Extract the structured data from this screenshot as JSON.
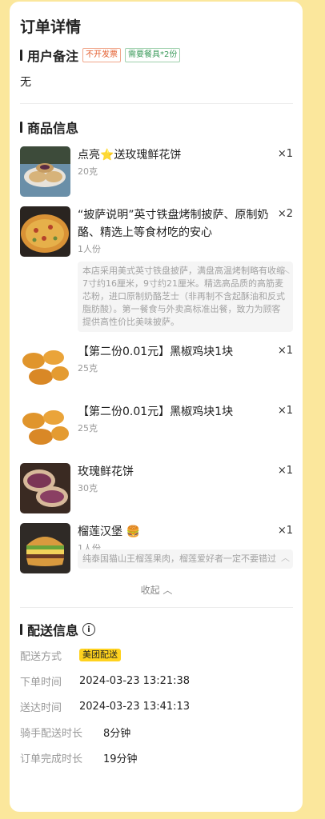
{
  "page_title": "订单详情",
  "remark_section": {
    "title": "用户备注",
    "tags": [
      "不开发票",
      "需要餐具*2份"
    ],
    "content": "无"
  },
  "products_section": {
    "title": "商品信息",
    "items": [
      {
        "name": "点亮",
        "star": "⭐",
        "name_suffix": "送玫瑰鲜花饼",
        "spec": "20克",
        "qty": "×1"
      },
      {
        "name": "“披萨说明”英寸铁盘烤制披萨、原制奶酪、精选上等食材吃的安心",
        "spec": "1人份",
        "qty": "×2",
        "desc": "本店采用美式英寸铁盘披萨，满盘高温烤制略有收缩7寸约16厘米，9寸约21厘米。精选高品质的高筋麦芯粉，进口原制奶酪芝士（非再制不含起酥油和反式脂肪酸）。第一餐食与外卖高标准出餐，致力为顾客提供高性价比美味披萨。",
        "desc_toggle": "︿"
      },
      {
        "name": "【第二份0.01元】黑椒鸡块1块",
        "spec": "25克",
        "qty": "×1"
      },
      {
        "name": "【第二份0.01元】黑椒鸡块1块",
        "spec": "25克",
        "qty": "×1"
      },
      {
        "name": "玫瑰鲜花饼",
        "spec": "30克",
        "qty": "×1"
      },
      {
        "name": "榴莲汉堡",
        "emoji": "🍔",
        "spec": "1人份",
        "qty": "×1",
        "desc": "纯泰国猫山王榴莲果肉，榴莲爱好者一定不要错过",
        "desc_toggle": "︿"
      }
    ],
    "collapse_label": "收起",
    "collapse_icon": "︿"
  },
  "delivery_section": {
    "title": "配送信息",
    "info_icon": "i",
    "rows": [
      {
        "label": "配送方式",
        "value": "美团配送"
      },
      {
        "label": "下单时间",
        "value": "2024-03-23 13:21:38"
      },
      {
        "label": "送达时间",
        "value": "2024-03-23 13:41:13"
      },
      {
        "label": "骑手配送时长",
        "value": "8分钟"
      },
      {
        "label": "订单完成时长",
        "value": "19分钟"
      }
    ]
  },
  "colors": {
    "background": "#fbe79c",
    "accent": "#ffd21e",
    "tag_red": "#e35d2e",
    "tag_green": "#3a9a5a"
  }
}
